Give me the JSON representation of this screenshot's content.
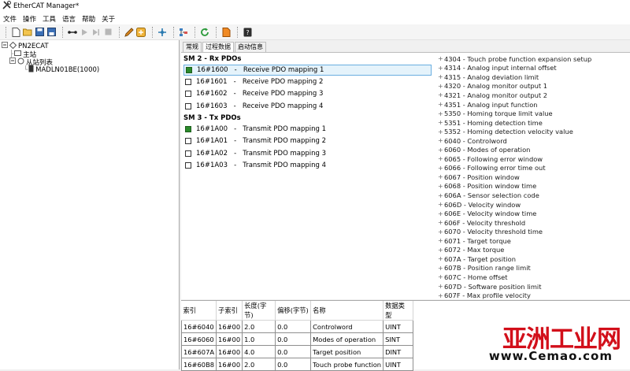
{
  "window": {
    "title": "EtherCAT Manager*"
  },
  "menu": [
    "文件",
    "操作",
    "工具",
    "语言",
    "帮助",
    "关于"
  ],
  "tree": {
    "root": "PN2ECAT",
    "master": "主站",
    "slave_list": "从站列表",
    "device": "MADLN01BE(1000)"
  },
  "tabs": [
    "常规",
    "过程数据",
    "启动信息"
  ],
  "sm2": {
    "title": "SM 2 - Rx PDOs",
    "pdos": [
      {
        "text": "16#1600   -   Receive PDO mapping 1",
        "checked": true
      },
      {
        "text": "16#1601   -   Receive PDO mapping 2",
        "checked": false
      },
      {
        "text": "16#1602   -   Receive PDO mapping 3",
        "checked": false
      },
      {
        "text": "16#1603   -   Receive PDO mapping 4",
        "checked": false
      }
    ]
  },
  "sm3": {
    "title": "SM 3 - Tx PDOs",
    "pdos": [
      {
        "text": "16#1A00   -   Transmit PDO mapping 1",
        "checked": true
      },
      {
        "text": "16#1A01   -   Transmit PDO mapping 2",
        "checked": false
      },
      {
        "text": "16#1A02   -   Transmit PDO mapping 3",
        "checked": false
      },
      {
        "text": "16#1A03   -   Transmit PDO mapping 4",
        "checked": false
      }
    ]
  },
  "objects": [
    "4304 - Touch probe function expansion setup",
    "4314 - Analog input internal offset",
    "4315 - Analog deviation limit",
    "4320 - Analog monitor output 1",
    "4321 - Analog monitor output 2",
    "4351 - Analog input function",
    "5350 - Homing torque limit value",
    "5351 - Homing detection time",
    "5352 - Homing detection velocity value",
    "6040 - Controlword",
    "6060 - Modes of operation",
    "6065 - Following error window",
    "6066 - Following error time out",
    "6067 - Position window",
    "6068 - Position window time",
    "606A - Sensor selection code",
    "606D - Velocity window",
    "606E - Velocity window time",
    "606F - Velocity threshold",
    "6070 - Velocity threshold time",
    "6071 - Target torque",
    "6072 - Max torque",
    "607A - Target position",
    "607B - Position range limit",
    "607C - Home offset",
    "607D - Software position limit",
    "607F - Max profile velocity"
  ],
  "grid": {
    "headers": [
      "索引",
      "子索引",
      "长度(字节)",
      "偏移(字节)",
      "名称",
      "数据类型"
    ],
    "rows": [
      [
        "16#6040",
        "16#00",
        "2.0",
        "0.0",
        "Controlword",
        "UINT"
      ],
      [
        "16#6060",
        "16#00",
        "1.0",
        "0.0",
        "Modes of operation",
        "SINT"
      ],
      [
        "16#607A",
        "16#00",
        "4.0",
        "0.0",
        "Target position",
        "DINT"
      ],
      [
        "16#60B8",
        "16#00",
        "2.0",
        "0.0",
        "Touch probe function",
        "UINT"
      ]
    ]
  },
  "watermark": {
    "zh": "亚洲工业网",
    "en": "www.Cemao.com"
  },
  "colors": {
    "accent": "#2b8a2b",
    "selection": "#e5f3fb",
    "watermark": "#d20f1a"
  }
}
